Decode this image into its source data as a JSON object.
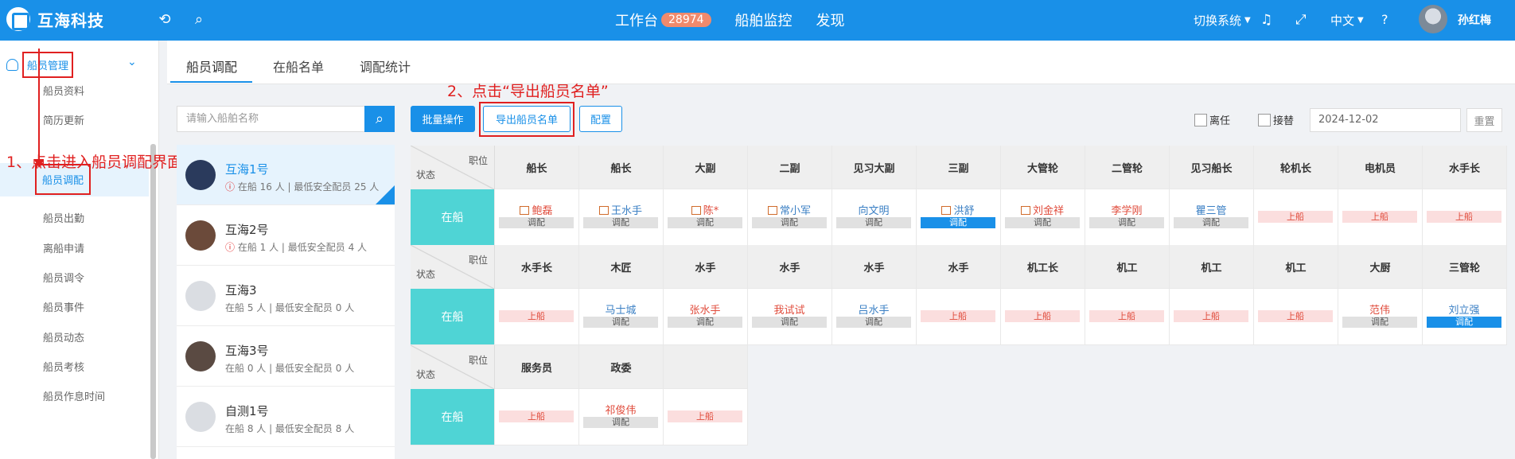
{
  "topbar": {
    "logo_text": "互海科技",
    "nav": [
      {
        "label": "工作台",
        "badge": "28974"
      },
      {
        "label": "船舶监控"
      },
      {
        "label": "发现"
      }
    ],
    "switch_system": "切换系统",
    "language": "中文",
    "user_name": "孙红梅"
  },
  "sidebar": {
    "parent": "船员管理",
    "items": [
      "船员资料",
      "简历更新",
      "船员调配",
      "船员出勤",
      "离船申请",
      "船员调令",
      "船员事件",
      "船员动态",
      "船员考核",
      "船员作息时间"
    ]
  },
  "annotations": {
    "step1": "1、点击进入船员调配界面",
    "step2": "2、点击“导出船员名单”"
  },
  "tabs": [
    "船员调配",
    "在船名单",
    "调配统计"
  ],
  "search": {
    "placeholder": "请输入船舶名称"
  },
  "toolbar": {
    "batch_label": "批量操作",
    "export_label": "导出船员名单",
    "config_label": "配置",
    "leave_label": "离任",
    "handover_label": "接替",
    "date_value": "2024-12-02",
    "reset_label": "重置"
  },
  "ships": [
    {
      "name": "互海1号",
      "meta": "在船 16 人 | 最低安全配员 25 人",
      "warn": true
    },
    {
      "name": "互海2号",
      "meta": "在船 1 人 | 最低安全配员 4 人",
      "warn": true
    },
    {
      "name": "互海3",
      "meta": "在船 5 人 | 最低安全配员 0 人",
      "warn": false
    },
    {
      "name": "互海3号",
      "meta": "在船 0 人 | 最低安全配员 0 人",
      "warn": false
    },
    {
      "name": "自测1号",
      "meta": "在船 8 人 | 最低安全配员 8 人",
      "warn": false
    }
  ],
  "table": {
    "corner_position": "职位",
    "corner_status": "状态",
    "onboard_label": "在船",
    "adjust_label": "调配",
    "board_label": "上船",
    "sections": [
      {
        "positions": [
          "船长",
          "船长",
          "大副",
          "二副",
          "见习大副",
          "三副",
          "大管轮",
          "二管轮",
          "见习船长",
          "轮机长",
          "电机员",
          "水手长"
        ],
        "crew": [
          {
            "name": "鲍磊",
            "color": "red",
            "cert": true
          },
          {
            "name": "王水手",
            "color": "blue",
            "cert": true
          },
          {
            "name": "陈*",
            "color": "red",
            "cert": true
          },
          {
            "name": "常小军",
            "color": "blue",
            "cert": true
          },
          {
            "name": "向文明",
            "color": "blue",
            "cert": false
          },
          {
            "name": "洪舒",
            "color": "blue",
            "cert": true,
            "active": true
          },
          {
            "name": "刘金祥",
            "color": "red",
            "cert": true
          },
          {
            "name": "李学刚",
            "color": "red",
            "cert": false
          },
          {
            "name": "瞿三管",
            "color": "blue",
            "cert": false
          },
          {
            "name": "",
            "board": true
          },
          {
            "name": "",
            "board": true
          },
          {
            "name": "",
            "board": true
          }
        ]
      },
      {
        "positions": [
          "水手长",
          "木匠",
          "水手",
          "水手",
          "水手",
          "水手",
          "机工长",
          "机工",
          "机工",
          "机工",
          "大厨",
          "三管轮"
        ],
        "crew": [
          {
            "name": "",
            "board": true
          },
          {
            "name": "马士城",
            "color": "blue"
          },
          {
            "name": "张水手",
            "color": "red"
          },
          {
            "name": "我试试",
            "color": "red"
          },
          {
            "name": "吕水手",
            "color": "blue"
          },
          {
            "name": "",
            "board": true
          },
          {
            "name": "",
            "board": true
          },
          {
            "name": "",
            "board": true
          },
          {
            "name": "",
            "board": true
          },
          {
            "name": "",
            "board": true
          },
          {
            "name": "范伟",
            "color": "red"
          },
          {
            "name": "刘立强",
            "color": "blue",
            "active": true
          }
        ]
      },
      {
        "positions": [
          "服务员",
          "政委",
          ""
        ],
        "crew": [
          {
            "name": "",
            "board": true
          },
          {
            "name": "祁俊伟",
            "color": "red"
          },
          {
            "name": "",
            "board": true
          }
        ]
      }
    ]
  }
}
